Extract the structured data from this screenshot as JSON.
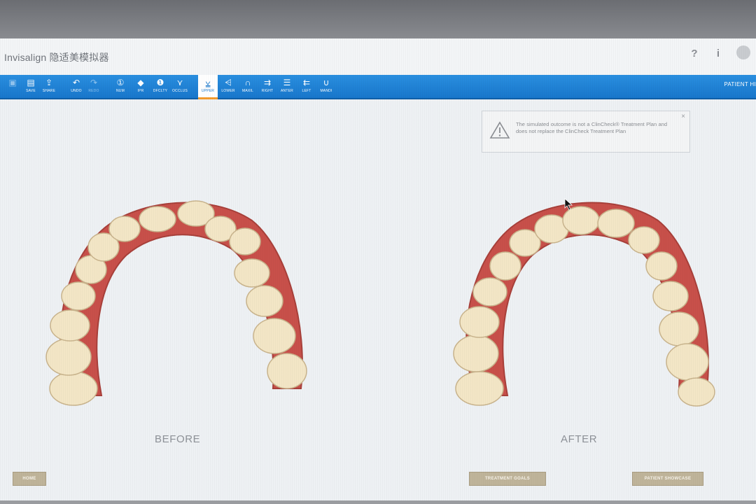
{
  "window": {
    "title": "Invisalign 隐适美模拟器"
  },
  "titlebar_icons": [
    {
      "name": "help-icon",
      "glyph": "?"
    },
    {
      "name": "info-icon",
      "glyph": "i"
    },
    {
      "name": "user-avatar-icon",
      "glyph": ""
    }
  ],
  "toolbar": {
    "items": [
      {
        "label": "",
        "icon": "open-icon",
        "glyph": "▣",
        "state": "disabled"
      },
      {
        "label": "SAVE",
        "icon": "save-icon",
        "glyph": "▤",
        "state": "normal"
      },
      {
        "label": "SHARE",
        "icon": "share-icon",
        "glyph": "⇪",
        "state": "normal"
      },
      {
        "label": "UNDO",
        "icon": "undo-icon",
        "glyph": "↶",
        "state": "normal"
      },
      {
        "label": "REDO",
        "icon": "redo-icon",
        "glyph": "↷",
        "state": "disabled"
      },
      {
        "label": "NUM",
        "icon": "numbering-icon",
        "glyph": "①",
        "state": "normal"
      },
      {
        "label": "IPR",
        "icon": "ipr-icon",
        "glyph": "◆",
        "state": "normal"
      },
      {
        "label": "DFCLTY",
        "icon": "difficulty-icon",
        "glyph": "❶",
        "state": "normal"
      },
      {
        "label": "OCCLUS",
        "icon": "occlusion-icon",
        "glyph": "⋎",
        "state": "normal"
      },
      {
        "label": "UPPER",
        "icon": "upper-arch-icon",
        "glyph": "⩣",
        "state": "active"
      },
      {
        "label": "LOWER",
        "icon": "lower-arch-icon",
        "glyph": "⩤",
        "state": "normal"
      },
      {
        "label": "MAXIL",
        "icon": "maxillary-icon",
        "glyph": "∩",
        "state": "normal"
      },
      {
        "label": "RIGHT",
        "icon": "right-view-icon",
        "glyph": "⇉",
        "state": "normal"
      },
      {
        "label": "ANTER",
        "icon": "anterior-view-icon",
        "glyph": "☰",
        "state": "normal"
      },
      {
        "label": "LEFT",
        "icon": "left-view-icon",
        "glyph": "⇇",
        "state": "normal"
      },
      {
        "label": "MANDI",
        "icon": "mandibular-icon",
        "glyph": "∪",
        "state": "normal"
      }
    ],
    "patient_label": "PATIENT HI"
  },
  "notice": {
    "text": "The simulated outcome is not a ClinCheck® Treatment Plan and does not replace the ClinCheck Treatment Plan",
    "close": "×",
    "icon": "warning-icon"
  },
  "views": {
    "before_label": "BEFORE",
    "after_label": "AFTER"
  },
  "bottom_buttons": {
    "left": "HOME",
    "middle": "TREATMENT GOALS",
    "right": "PATIENT SHOWCASE"
  },
  "colors": {
    "toolbar": "#1a7fd4",
    "active_tab_underline": "#f39b2e",
    "gum": "#c8504a",
    "tooth": "#f3e6c6",
    "button_bg": "#bfb49a"
  }
}
